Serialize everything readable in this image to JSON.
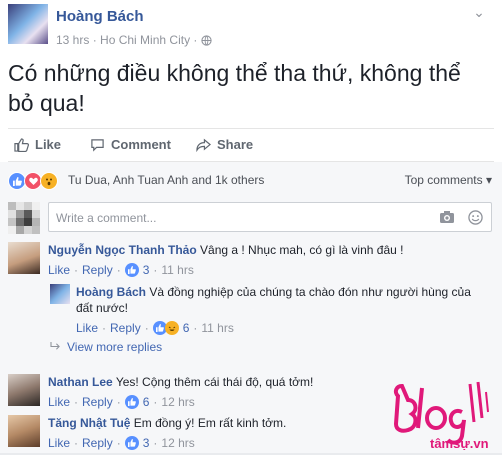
{
  "post": {
    "author": "Hoàng Bách",
    "time": "13 hrs",
    "location": "Ho Chi Minh City",
    "privacy_icon": "globe-icon",
    "text": "Có những điều không thể tha thứ, không thể bỏ qua!"
  },
  "actions": {
    "like": "Like",
    "comment": "Comment",
    "share": "Share"
  },
  "reactions": {
    "names": "Tu Dua, Anh Tuan Anh and 1k others",
    "sort": "Top comments"
  },
  "write": {
    "placeholder": "Write a comment..."
  },
  "comments": [
    {
      "name": "Nguyễn Ngọc Thanh Thảo",
      "text": "Vâng a ! Nhục mah, có gì là vinh đâu !",
      "like_label": "Like",
      "reply_label": "Reply",
      "count": "3",
      "time": "11 hrs",
      "reply": {
        "name": "Hoàng Bách",
        "text": "Và đồng nghiệp của chúng ta chào đón như người hùng của đất nước!",
        "like_label": "Like",
        "reply_label": "Reply",
        "count": "6",
        "time": "11 hrs"
      },
      "view_more": "View more replies"
    },
    {
      "name": "Nathan Lee",
      "text": "Yes! Cộng thêm cái thái độ, quá tởm!",
      "like_label": "Like",
      "reply_label": "Reply",
      "count": "6",
      "time": "12 hrs"
    },
    {
      "name": "Tăng Nhật Tuệ",
      "text": "Em đồng ý! Em rất kinh tởm.",
      "like_label": "Like",
      "reply_label": "Reply",
      "count": "3",
      "time": "12 hrs"
    }
  ],
  "watermark": {
    "text": "Blog tâmsự.vn",
    "color": "#e0197a"
  },
  "colors": {
    "link": "#365899",
    "action_link": "#4267b2",
    "like_blue": "#5890ff",
    "meta_grey": "#90949c"
  }
}
